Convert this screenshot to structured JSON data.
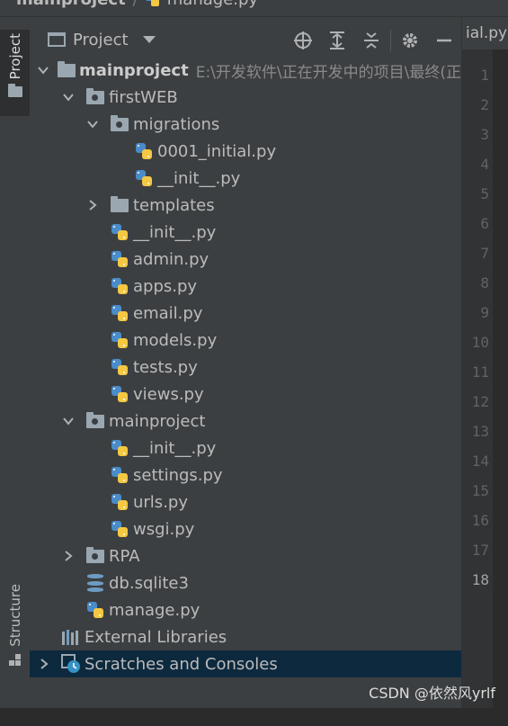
{
  "breadcrumb": {
    "project": "mainproject",
    "file": "manage.py"
  },
  "toolstrip": {
    "project_tab": "Project",
    "structure_tab": "Structure"
  },
  "panel": {
    "title": "Project"
  },
  "tree": [
    {
      "depth": 0,
      "expanded": true,
      "icon": "folder-icon",
      "label": "mainproject",
      "bold": true,
      "path": "E:\\开发软件\\正在开发中的项目\\最终(正"
    },
    {
      "depth": 1,
      "expanded": true,
      "icon": "package-folder-icon",
      "label": "firstWEB"
    },
    {
      "depth": 2,
      "expanded": true,
      "icon": "package-folder-icon",
      "label": "migrations"
    },
    {
      "depth": 3,
      "icon": "python-file-icon",
      "label": "0001_initial.py"
    },
    {
      "depth": 3,
      "icon": "python-file-icon",
      "label": "__init__.py"
    },
    {
      "depth": 2,
      "expanded": false,
      "icon": "folder-icon",
      "label": "templates"
    },
    {
      "depth": 2,
      "icon": "python-file-icon",
      "label": "__init__.py"
    },
    {
      "depth": 2,
      "icon": "python-file-icon",
      "label": "admin.py"
    },
    {
      "depth": 2,
      "icon": "python-file-icon",
      "label": "apps.py"
    },
    {
      "depth": 2,
      "icon": "python-file-icon",
      "label": "email.py"
    },
    {
      "depth": 2,
      "icon": "python-file-icon",
      "label": "models.py"
    },
    {
      "depth": 2,
      "icon": "python-file-icon",
      "label": "tests.py"
    },
    {
      "depth": 2,
      "icon": "python-file-icon",
      "label": "views.py"
    },
    {
      "depth": 1,
      "expanded": true,
      "icon": "package-folder-icon",
      "label": "mainproject"
    },
    {
      "depth": 2,
      "icon": "python-file-icon",
      "label": "__init__.py"
    },
    {
      "depth": 2,
      "icon": "python-file-icon",
      "label": "settings.py"
    },
    {
      "depth": 2,
      "icon": "python-file-icon",
      "label": "urls.py"
    },
    {
      "depth": 2,
      "icon": "python-file-icon",
      "label": "wsgi.py"
    },
    {
      "depth": 1,
      "expanded": false,
      "icon": "package-folder-icon",
      "label": "RPA"
    },
    {
      "depth": 1,
      "icon": "database-icon",
      "label": "db.sqlite3"
    },
    {
      "depth": 1,
      "icon": "python-file-icon",
      "label": "manage.py"
    },
    {
      "depth": 0,
      "icon": "libraries-icon",
      "label": "External Libraries"
    },
    {
      "depth": 0,
      "expanded": false,
      "icon": "scratches-icon",
      "label": "Scratches and Consoles",
      "selected": true
    }
  ],
  "editor": {
    "tab_label": "ial.py",
    "line_numbers": [
      "1",
      "2",
      "3",
      "4",
      "5",
      "6",
      "7",
      "8",
      "9",
      "10",
      "11",
      "12",
      "13",
      "14",
      "15",
      "16",
      "17",
      "18"
    ],
    "current_line": "18"
  },
  "colors": {
    "panel_bg": "#3c3f41",
    "editor_bg": "#2b2b2b",
    "selection": "#0d293e",
    "folder": "#9aa7b0"
  },
  "watermark": "CSDN @依然风yrlf"
}
